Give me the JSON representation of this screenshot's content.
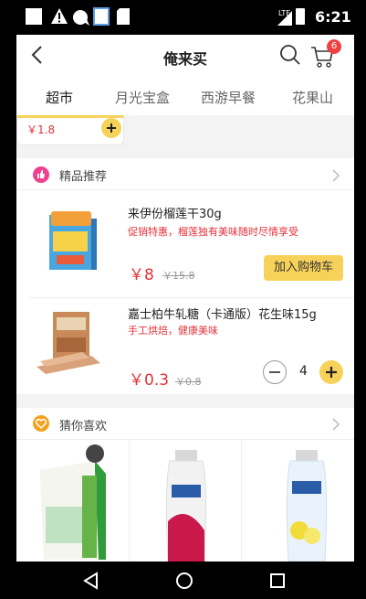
{
  "status_bar": {
    "network": "LTE",
    "time": "6:21"
  },
  "header": {
    "title": "俺来买",
    "cart_badge": "6"
  },
  "tabs": [
    {
      "label": "超市"
    },
    {
      "label": "月光宝盒"
    },
    {
      "label": "西游早餐"
    },
    {
      "label": "花果山"
    }
  ],
  "partial_item": {
    "price": "￥1.8"
  },
  "featured": {
    "title": "精品推荐",
    "products": [
      {
        "name": "来伊份榴莲干30g",
        "desc": "促销特惠，榴莲独有美味随时尽情享受",
        "price": "￥8",
        "old_price": "￥15.8",
        "action_label": "加入购物车"
      },
      {
        "name": "嘉士柏牛轧糖（卡通版）花生味15g",
        "desc": "手工烘焙，健康美味",
        "price": "￥0.3",
        "old_price": "￥0.8",
        "quantity": "4"
      }
    ]
  },
  "guess": {
    "title": "猜你喜欢"
  },
  "colors": {
    "accent": "#f7d25a",
    "price": "#e4323a",
    "badge": "#f04142"
  }
}
